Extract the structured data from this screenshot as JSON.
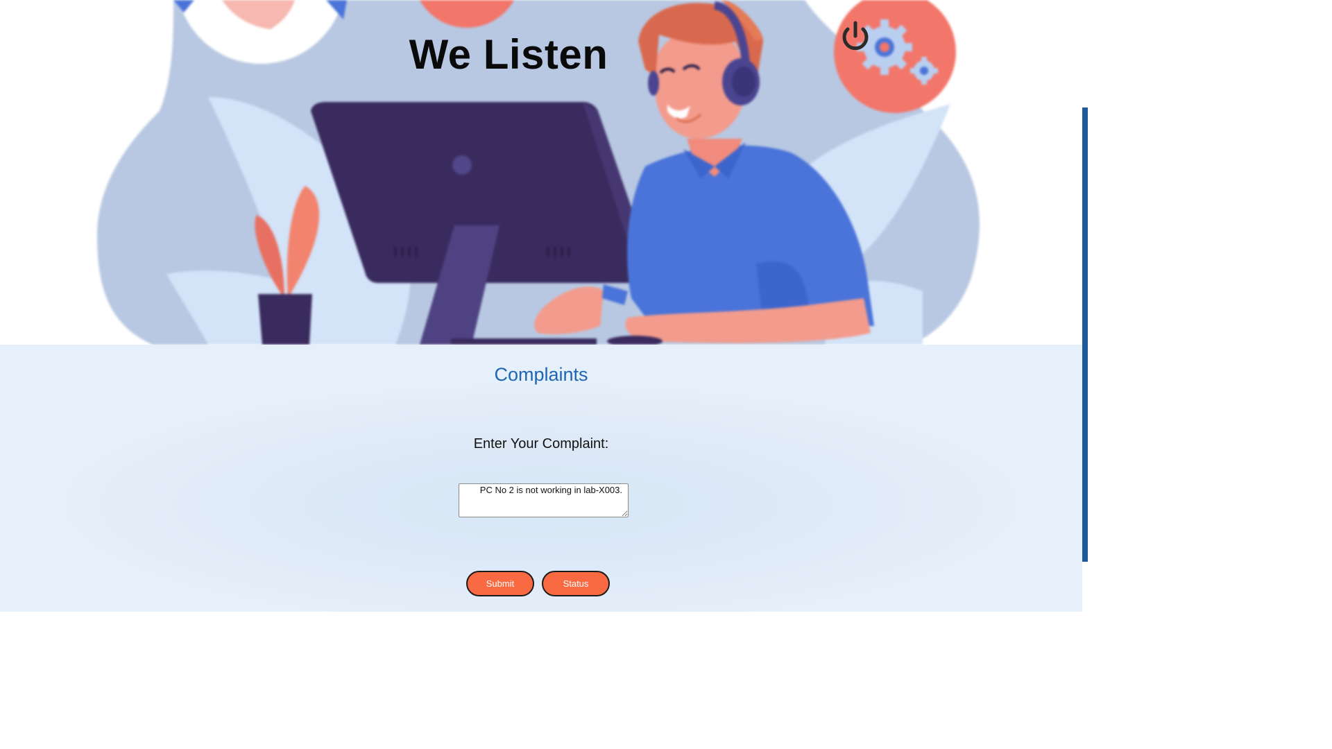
{
  "hero": {
    "title": "We Listen",
    "illustration": "support-agent-at-computer-illustration",
    "power_icon": "power-icon",
    "gear_icon": "gear-icon"
  },
  "form": {
    "heading": "Complaints",
    "label": "Enter Your Complaint:",
    "complaint_value": "PC No 2 is not working in lab-X003.",
    "submit_label": "Submit",
    "status_label": "Status"
  },
  "colors": {
    "accent_heading": "#1f65b3",
    "button_fill": "#f96a43",
    "hero_blob": "#b8c8e2",
    "shirt": "#4a74d9",
    "monitor": "#392b5e",
    "coral": "#f2766a",
    "scrollbar": "#1f5a9a"
  }
}
